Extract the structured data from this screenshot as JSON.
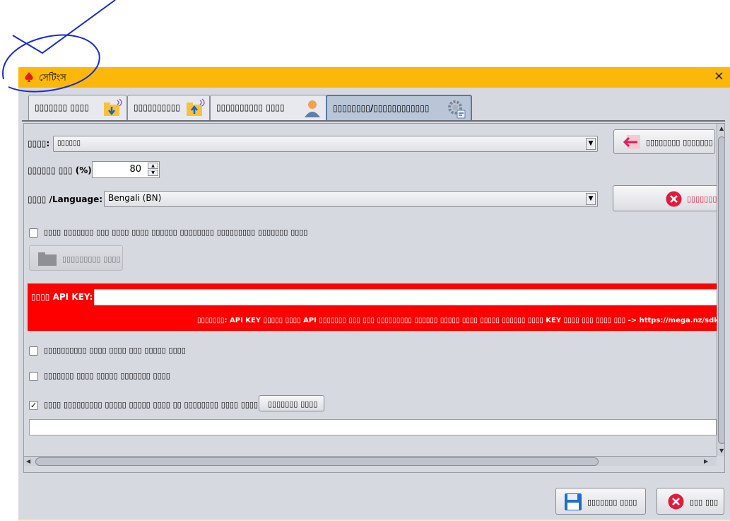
{
  "window": {
    "title": "সেটিংস",
    "close_glyph": "×"
  },
  "tabs": [
    {
      "label": "▯▯▯▯▯▯▯ ▯▯▯▯",
      "icon": "folder-download-icon"
    },
    {
      "label": "▯▯▯▯▯▯▯▯▯▯",
      "icon": "folder-upload-icon"
    },
    {
      "label": "▯▯▯▯▯▯▯▯▯▯ ▯▯▯▯",
      "icon": "user-icon"
    },
    {
      "label": "▯▯▯▯▯▯▯▯/▯▯▯▯▯▯▯▯▯▯▯▯",
      "icon": "gear-icon",
      "active": true
    }
  ],
  "form": {
    "theme_label": "▯▯▯▯:",
    "theme_value": "▯▯▯▯▯▯",
    "reset_button": "▯▯▯▯▯▯▯▯ ▯▯▯▯▯▯▯",
    "zoom_label": "▯▯▯▯▯▯ ▯▯▯ (%):",
    "zoom_value": "80",
    "language_label": "▯▯▯▯ /Language:",
    "language_value": "Bengali (BN)",
    "cancel_partial": "▯▯▯▯▯▯▯",
    "custom_folder_checkbox": "▯▯▯▯ ▯▯▯▯▯▯▯ ▯▯▯ ▯▯▯▯ ▯▯▯▯ ▯▯▯▯▯▯ ▯▯▯▯▯▯▯▯ ▯▯▯▯▯▯▯▯▯ ▯▯▯▯▯▯▯ ▯▯▯▯",
    "choose_folder_button": "▯▯▯▯▯▯▯▯▯ ▯▯▯▯",
    "api_key_label": "▯▯▯▯ API KEY:",
    "api_key_value": "",
    "api_note": "▯▯▯▯▯▯▯: API KEY ▯▯▯▯▯ ▯▯▯▯ API ▯▯▯▯▯▯▯ ▯▯▯ ▯▯▯ ▯▯▯▯▯▯▯▯▯ ▯▯▯▯▯▯ ▯▯▯▯▯ ▯▯▯▯ ▯▯▯▯▯ ▯▯▯▯▯▯ ▯▯▯▯ KEY ▯▯▯▯ ▯▯▯ ▯▯▯▯ ▯▯▯ -> https://mega.nz/sdk",
    "checkbox1": "▯▯▯▯▯▯▯▯▯▯ ▯▯▯▯ ▯▯▯▯ ▯▯▯ ▯▯▯▯▯ ▯▯▯▯",
    "checkbox2": "▯▯▯▯▯▯▯ ▯▯▯▯ ▯▯▯▯▯ ▯▯▯▯▯▯▯ ▯▯▯▯",
    "checkbox3": "▯▯▯▯ ▯▯▯▯▯▯▯▯▯ ▯▯▯▯▯ ▯▯▯▯▯ ▯▯▯▯ ▯▯ ▯▯▯▯▯▯▯▯ ▯▯▯▯ ▯▯▯▯:",
    "checkbox3_checked": true,
    "checkbox3_button": "▯▯▯▯▯▯▯ ▯▯▯▯",
    "path_value": ""
  },
  "footer": {
    "save_button": "▯▯▯▯▯▯▯ ▯▯▯▯",
    "close_button": "▯▯▯ ▯▯▯"
  }
}
